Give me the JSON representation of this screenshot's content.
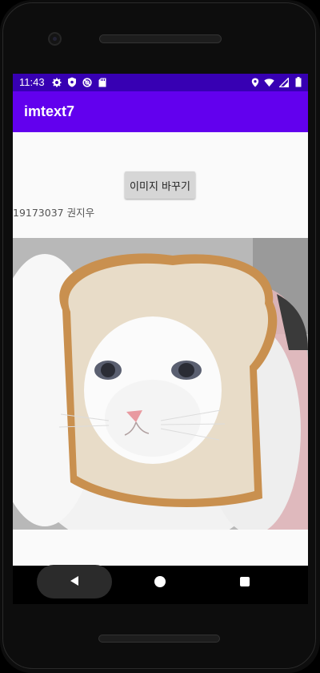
{
  "status_bar": {
    "time": "11:43",
    "left_icons": [
      "gear-icon",
      "shield-icon",
      "no-sync-icon",
      "sd-card-icon"
    ],
    "right_icons": [
      "location-icon",
      "wifi-icon",
      "signal-icon",
      "battery-icon"
    ],
    "color": "#3700b3"
  },
  "app_bar": {
    "title": "imtext7",
    "color": "#6200ee"
  },
  "main": {
    "button_label": "이미지 바꾸기",
    "student_label": "19173037 권지우",
    "image": "cat-in-bread-photo"
  },
  "nav_bar": {
    "icons": [
      "back-icon",
      "home-icon",
      "recents-icon"
    ]
  }
}
